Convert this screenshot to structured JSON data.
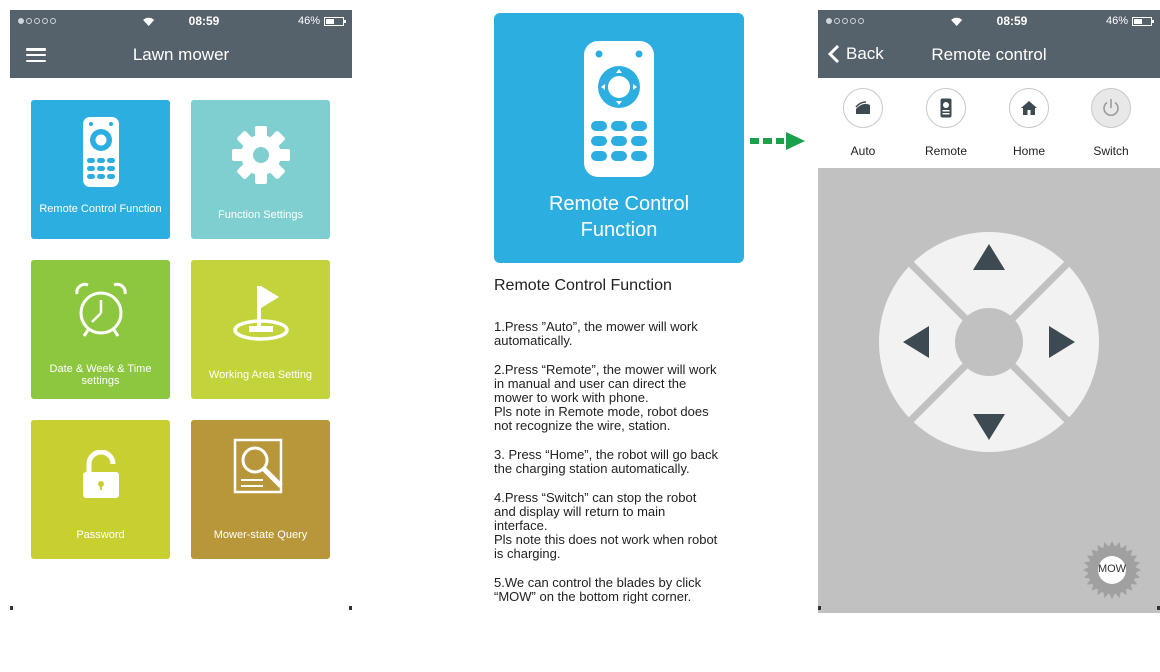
{
  "status_bar": {
    "time": "08:59",
    "battery": "46%"
  },
  "left_screen": {
    "title": "Lawn mower",
    "tiles": [
      {
        "label": "Remote Control Function",
        "color": "#2caee0"
      },
      {
        "label": "Function Settings",
        "color": "#7fcfd0"
      },
      {
        "label": "Date & Week & Time settings",
        "color": "#8dc63f"
      },
      {
        "label": "Working Area Setting",
        "color": "#c2d33c"
      },
      {
        "label": "Password",
        "color": "#c8cf31"
      },
      {
        "label": "Mower-state Query",
        "color": "#b8963a"
      }
    ]
  },
  "center": {
    "tile_label_line1": "Remote Control",
    "tile_label_line2": "Function",
    "title": "Remote Control Function",
    "paragraphs": [
      "1.Press ”Auto”, the mower will work\nautomatically.",
      "2.Press “Remote”, the mower will work\nin manual and user can direct the\nmower to work with phone.\nPls note in Remote mode, robot does\nnot recognize the wire, station.",
      "3. Press  “Home”, the robot will go back\nthe charging station automatically.",
      "4.Press “Switch” can stop the robot\nand display will return to main\ninterface.\nPls note this does not work when robot\nis charging.",
      "5.We can control the blades by click\n“MOW” on the bottom right corner."
    ]
  },
  "right_screen": {
    "back_label": "Back",
    "title": "Remote control",
    "modes": [
      "Auto",
      "Remote",
      "Home",
      "Switch"
    ],
    "mow_label": "MOW"
  },
  "colors": {
    "header": "#56626b",
    "arrow": "#1aa14a",
    "pad_bg": "#c1c1c1"
  }
}
